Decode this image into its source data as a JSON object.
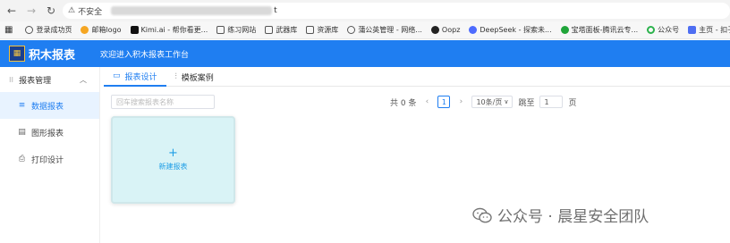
{
  "browser": {
    "security_label": "不安全",
    "url_tail": "t",
    "bookmarks": [
      {
        "label": "登录成功页",
        "icon": "globe-icon"
      },
      {
        "label": "邮箱logo",
        "icon": "mail-icon"
      },
      {
        "label": "Kimi.ai - 帮你看更...",
        "icon": "kimi-icon"
      },
      {
        "label": "练习网站",
        "icon": "folder-icon"
      },
      {
        "label": "武器库",
        "icon": "folder-icon"
      },
      {
        "label": "资源库",
        "icon": "folder-icon"
      },
      {
        "label": "蒲公英管理 - 网络...",
        "icon": "globe-icon"
      },
      {
        "label": "Oopz",
        "icon": "oopz-icon"
      },
      {
        "label": "DeepSeek - 探索未...",
        "icon": "deepseek-icon"
      },
      {
        "label": "宝塔面板-腾讯云专...",
        "icon": "bt-icon"
      },
      {
        "label": "公众号",
        "icon": "wechat-icon"
      },
      {
        "label": "主页 - 扣子",
        "icon": "coze-icon"
      }
    ]
  },
  "app": {
    "logo_text": "积木报表",
    "welcome": "欢迎进入积木报表工作台",
    "brand_color": "#1f7ef1"
  },
  "sidebar": {
    "group_label": "报表管理",
    "items": [
      {
        "label": "数据报表",
        "active": true,
        "icon": "list-icon"
      },
      {
        "label": "图形报表",
        "active": false,
        "icon": "chart-icon"
      },
      {
        "label": "打印设计",
        "active": false,
        "icon": "printer-icon"
      }
    ]
  },
  "tabs": [
    {
      "label": "报表设计",
      "active": true,
      "icon": "monitor-icon"
    },
    {
      "label": "模板案例",
      "active": false,
      "icon": "sliders-icon"
    }
  ],
  "search": {
    "placeholder": "回车搜索报表名称"
  },
  "pager": {
    "total": "共 0 条",
    "current_page": "1",
    "page_size": "10条/页",
    "jump_label": "跳至",
    "jump_value": "1",
    "page_unit": "页"
  },
  "card": {
    "label": "新建报表"
  },
  "watermark": {
    "text": "公众号 · 晨星安全团队"
  }
}
